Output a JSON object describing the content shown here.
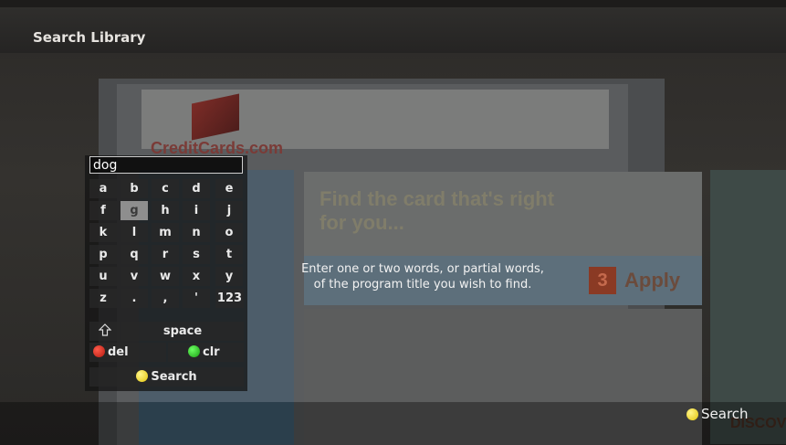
{
  "window": {
    "title": "Search Library"
  },
  "search": {
    "query": "dog"
  },
  "keyboard": {
    "rows": [
      [
        "a",
        "b",
        "c",
        "d",
        "e"
      ],
      [
        "f",
        "g",
        "h",
        "i",
        "j"
      ],
      [
        "k",
        "l",
        "m",
        "n",
        "o"
      ],
      [
        "p",
        "q",
        "r",
        "s",
        "t"
      ],
      [
        "u",
        "v",
        "w",
        "x",
        "y"
      ]
    ],
    "row6": [
      "z",
      ".",
      ",",
      "'",
      "123"
    ],
    "selected": "g",
    "space_label": "space",
    "shift_icon": "shift-arrow-icon",
    "del_label": "del",
    "clr_label": "clr",
    "search_label": "Search"
  },
  "instruction": {
    "line1": "Enter one or two words, or partial words,",
    "line2": "of the program title you wish to find."
  },
  "footer": {
    "search_label": "Search"
  },
  "background_page": {
    "logo_text": "CreditCards.com",
    "hero_text": "Find the card that's right for you...",
    "apply_step": "3",
    "apply_text": "Apply",
    "partner_text": "DISCOVER"
  },
  "colors": {
    "red_button": "#d1281a",
    "green_button": "#2bbf22",
    "yellow_button": "#f2d51b",
    "selected_key": "#8e8e8e"
  }
}
